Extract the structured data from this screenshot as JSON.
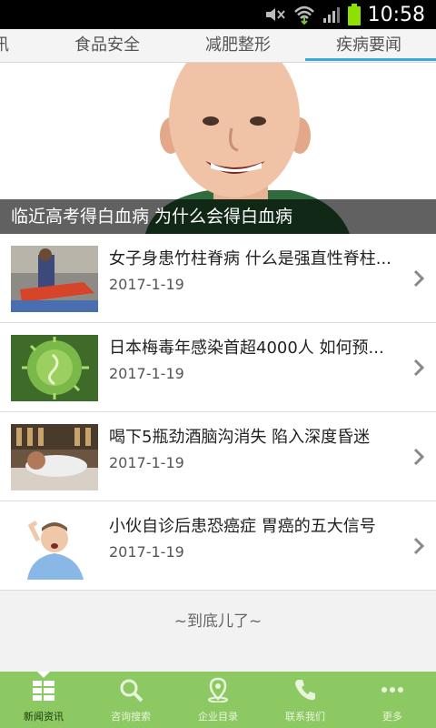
{
  "status_bar": {
    "time": "10:58",
    "icons": [
      "mute-icon",
      "wifi-icon",
      "signal-icon",
      "battery-icon"
    ]
  },
  "tabs": [
    {
      "label": "讯",
      "active": false
    },
    {
      "label": "食品安全",
      "active": false
    },
    {
      "label": "减肥整形",
      "active": false
    },
    {
      "label": "疾病要闻",
      "active": true
    }
  ],
  "hero": {
    "caption": "临近高考得白血病 为什么会得白血病"
  },
  "news": [
    {
      "title": "女子身患竹柱脊病 什么是强直性脊柱...",
      "date": "2017-1-19"
    },
    {
      "title": "日本梅毒年感染首超4000人 如何预...",
      "date": "2017-1-19"
    },
    {
      "title": "喝下5瓶劲酒脑沟消失 陷入深度昏迷",
      "date": "2017-1-19"
    },
    {
      "title": "小伙自诊后患恐癌症 胃癌的五大信号",
      "date": "2017-1-19"
    }
  ],
  "end_text": "~到底儿了~",
  "bottom_nav": [
    {
      "label": "新闻资讯",
      "icon": "news-grid-icon",
      "active": true
    },
    {
      "label": "咨询搜索",
      "icon": "search-icon",
      "active": false
    },
    {
      "label": "企业目录",
      "icon": "location-pin-icon",
      "active": false
    },
    {
      "label": "联系我们",
      "icon": "phone-icon",
      "active": false
    },
    {
      "label": "更多",
      "icon": "more-dots-icon",
      "active": false
    }
  ],
  "colors": {
    "accent_tab": "#39a9d9",
    "bottom_nav": "#8dc963"
  }
}
